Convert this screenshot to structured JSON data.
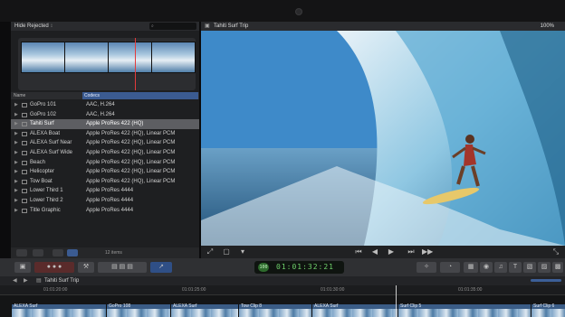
{
  "browser": {
    "filter_label": "Hide Rejected",
    "list_header": {
      "name": "Name",
      "codecs": "Codecs"
    },
    "items": [
      {
        "name": "GoPro 101",
        "codec": "AAC, H.264"
      },
      {
        "name": "GoPro 102",
        "codec": "AAC, H.264"
      },
      {
        "name": "Tahiti Surf",
        "codec": "Apple ProRes 422 (HQ)"
      },
      {
        "name": "ALEXA Boat",
        "codec": "Apple ProRes 422 (HQ), Linear PCM"
      },
      {
        "name": "ALEXA Surf Near",
        "codec": "Apple ProRes 422 (HQ), Linear PCM"
      },
      {
        "name": "ALEXA Surf Wide",
        "codec": "Apple ProRes 422 (HQ), Linear PCM"
      },
      {
        "name": "Beach",
        "codec": "Apple ProRes 422 (HQ), Linear PCM"
      },
      {
        "name": "Helicopter",
        "codec": "Apple ProRes 422 (HQ), Linear PCM"
      },
      {
        "name": "Tow Boat",
        "codec": "Apple ProRes 422 (HQ), Linear PCM"
      },
      {
        "name": "Lower Third 1",
        "codec": "Apple ProRes 4444"
      },
      {
        "name": "Lower Third 2",
        "codec": "Apple ProRes 4444"
      },
      {
        "name": "Title Graphic",
        "codec": "Apple ProRes 4444"
      }
    ],
    "selected_index": 2,
    "item_count": "12 items"
  },
  "viewer": {
    "title": "Tahiti Surf Trip",
    "zoom": "100%"
  },
  "toolbar": {
    "timecode": "01:01:32:21",
    "timecode_badge": "100"
  },
  "timeline": {
    "project_title": "Tahiti Surf Trip",
    "ruler_marks": [
      "01:01:20:00",
      "01:01:25:00",
      "01:01:30:00",
      "01:01:35:00"
    ],
    "clips": [
      {
        "label": "ALEXA Surf"
      },
      {
        "label": "GoPro 108"
      },
      {
        "label": "ALEXA Surf"
      },
      {
        "label": "Tow Clip 8"
      },
      {
        "label": "ALEXA Surf"
      },
      {
        "label": "Surf Clip 5"
      },
      {
        "label": "Surf Clip 6"
      }
    ]
  },
  "colors": {
    "selection": "#5d5e62",
    "codec_header": "#3b5b91",
    "timecode_green": "#6fd06b",
    "clip_blue": "#3a5c86",
    "playhead_red": "#e23b3b"
  }
}
